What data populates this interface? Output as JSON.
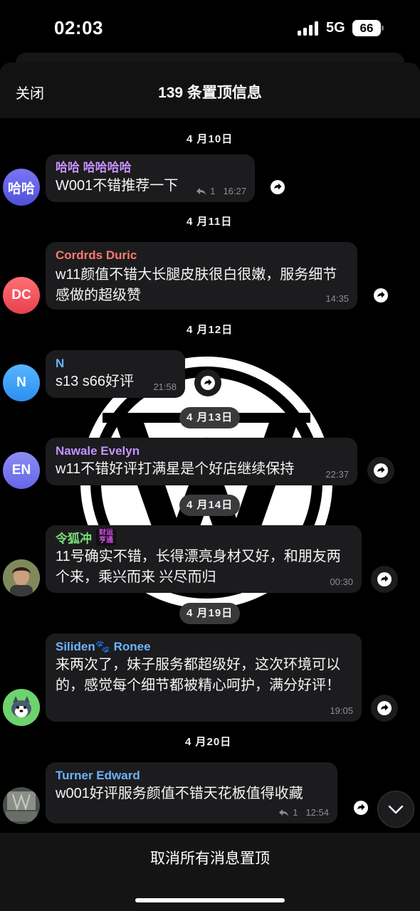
{
  "status_bar": {
    "time": "02:03",
    "network": "5G",
    "battery": "66"
  },
  "header": {
    "close_label": "关闭",
    "title": "139 条置顶信息"
  },
  "messages": [
    {
      "date": "4 月10日",
      "sender": "哈哈 哈哈哈哈",
      "avatar_text": "哈哈",
      "avatar_color": "#5b5be6",
      "name_color": "#c592ff",
      "text": "W001不错推荐一下",
      "replies": "1",
      "time": "16:27"
    },
    {
      "date": "4 月11日",
      "sender": "Cordrds Duric",
      "avatar_text": "DC",
      "avatar_color": "#f04f57",
      "name_color": "#ff7b6b",
      "text": "w11颜值不错大长腿皮肤很白很嫩，服务细节感做的超级赞",
      "time": "14:35"
    },
    {
      "date": "4 月12日",
      "sender": "N",
      "avatar_text": "N",
      "avatar_color": "#3b9cf5",
      "name_color": "#6cb4ff",
      "text": "s13 s66好评",
      "time": "21:58"
    },
    {
      "date": "4 月13日",
      "sender": "Nawale Evelyn",
      "avatar_text": "EN",
      "avatar_color": "#7b7cf0",
      "name_color": "#c592ff",
      "text": "w11不错好评打满星是个好店继续保持",
      "time": "22:37"
    },
    {
      "date": "4 月14日",
      "sender": "令狐冲",
      "badge_line1": "财运",
      "badge_line2": "亨通",
      "name_color": "#7be07b",
      "text": "11号确实不错，长得漂亮身材又好，和朋友两个来，乘兴而来 兴尽而归",
      "time": "00:30"
    },
    {
      "date": "4 月19日",
      "sender": "Siliden🐾 Ronee",
      "name_color": "#6cb4ff",
      "text": "来两次了，妹子服务都超级好，这次环境可以的，感觉每个细节都被精心呵护，满分好评！",
      "time": "19:05"
    },
    {
      "date": "4 月20日",
      "sender": "Turner Edward",
      "name_color": "#6cb4ff",
      "text": "w001好评服务颜值不错天花板值得收藏",
      "replies": "1",
      "time": "12:54"
    }
  ],
  "footer": {
    "unpin_all_label": "取消所有消息置顶"
  }
}
